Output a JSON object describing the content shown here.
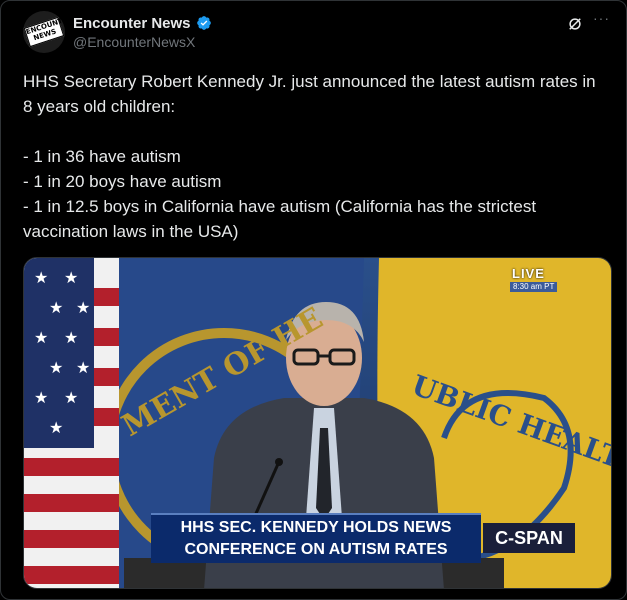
{
  "author": {
    "display_name": "Encounter News",
    "handle": "@EncounterNewsX",
    "avatar_text": "ENCOUNTER NEWS",
    "verified": true
  },
  "post": {
    "lines": [
      "HHS Secretary Robert Kennedy Jr. just announced the latest autism rates in 8 years old children:",
      "",
      "- 1 in 36 have autism",
      "- 1 in 20 boys have autism",
      "- 1 in 12.5 boys in California have autism (California has the strictest vaccination laws in the USA)"
    ]
  },
  "media": {
    "live_label": "LIVE",
    "time_label": "8:30 am PT",
    "chyron_line1": "HHS SEC. KENNEDY HOLDS NEWS",
    "chyron_line2": "CONFERENCE ON AUTISM RATES",
    "network": "C-SPAN",
    "flag_text_left": "MENT OF HE",
    "flag_text_right": "UBLIC HEALTH"
  },
  "icons": {
    "verified": "verified-badge-icon",
    "grok": "grok-icon",
    "more": "more-icon"
  },
  "colors": {
    "background": "#000000",
    "text": "#e7e9ea",
    "secondary_text": "#71767b",
    "verified_blue": "#1d9bf0",
    "chyron_blue": "#0b2a6b"
  }
}
